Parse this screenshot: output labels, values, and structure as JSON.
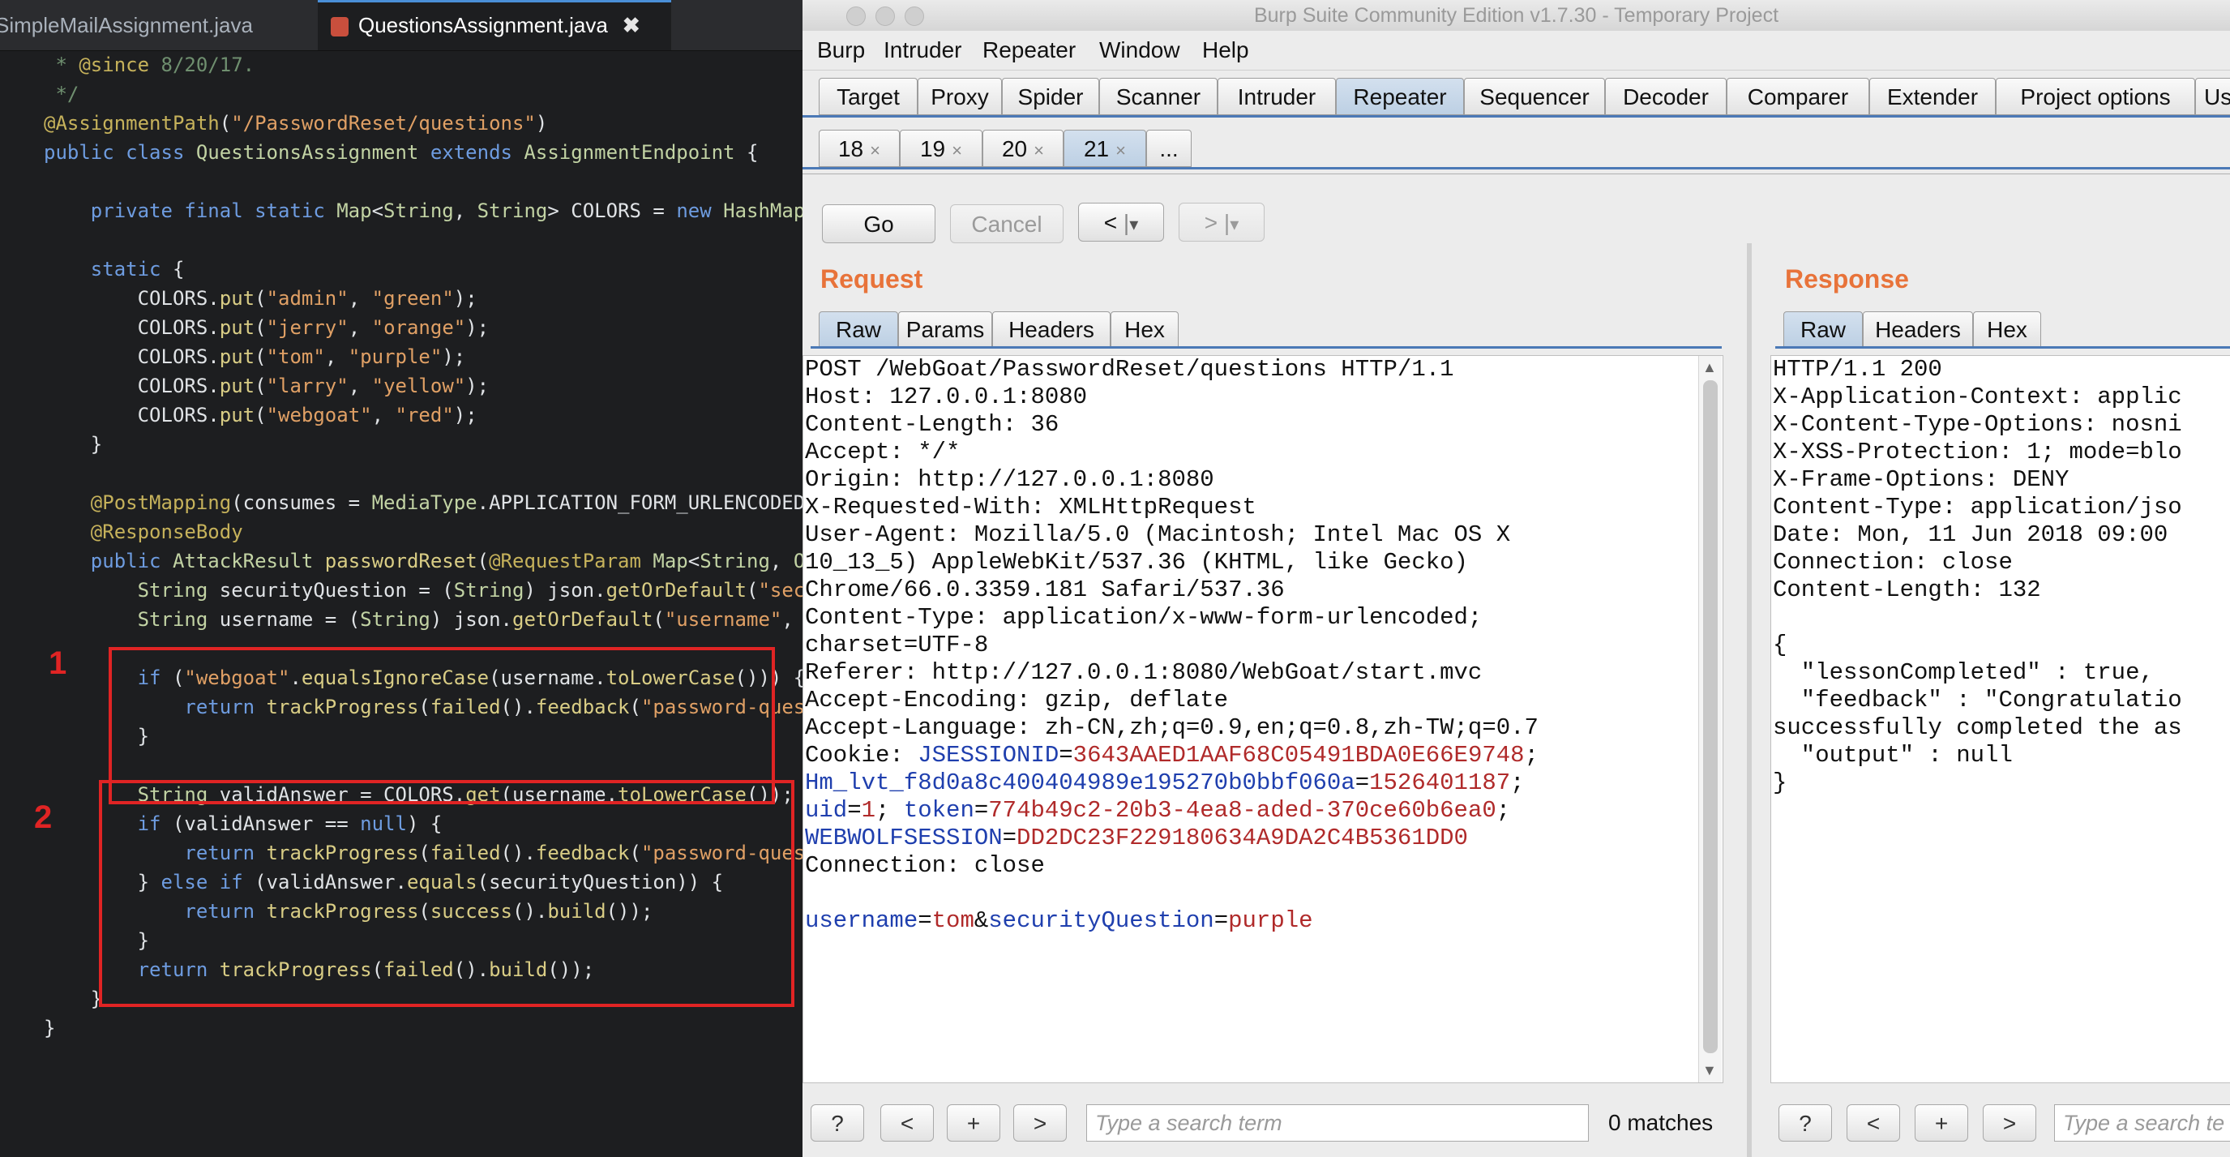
{
  "ide": {
    "tabs": [
      {
        "label": "SimpleMailAssignment.java",
        "active": false
      },
      {
        "label": "QuestionsAssignment.java",
        "active": true,
        "close": "✖"
      }
    ],
    "annotations": [
      "1",
      "2"
    ]
  },
  "burp": {
    "title": "Burp Suite Community Edition v1.7.30 - Temporary Project",
    "menu": [
      "Burp",
      "Intruder",
      "Repeater",
      "Window",
      "Help"
    ],
    "tool_tabs": [
      "Target",
      "Proxy",
      "Spider",
      "Scanner",
      "Intruder",
      "Repeater",
      "Sequencer",
      "Decoder",
      "Comparer",
      "Extender",
      "Project options",
      "Us"
    ],
    "active_tool_tab": "Repeater",
    "repeater_tabs": [
      "18",
      "19",
      "20",
      "21"
    ],
    "active_repeater_tab": "21",
    "repeater_more": "...",
    "tab_close": "×",
    "controls": {
      "go": "Go",
      "cancel": "Cancel",
      "back": "<",
      "forward": ">",
      "dropdown": "▾",
      "sep": "|"
    },
    "request": {
      "title": "Request",
      "tabs": [
        "Raw",
        "Params",
        "Headers",
        "Hex"
      ],
      "active_tab": "Raw",
      "lines": [
        "POST /WebGoat/PasswordReset/questions HTTP/1.1",
        "Host: 127.0.0.1:8080",
        "Content-Length: 36",
        "Accept: */*",
        "Origin: http://127.0.0.1:8080",
        "X-Requested-With: XMLHttpRequest",
        "User-Agent: Mozilla/5.0 (Macintosh; Intel Mac OS X",
        "10_13_5) AppleWebKit/537.36 (KHTML, like Gecko)",
        "Chrome/66.0.3359.181 Safari/537.36",
        "Content-Type: application/x-www-form-urlencoded;",
        "charset=UTF-8",
        "Referer: http://127.0.0.1:8080/WebGoat/start.mvc",
        "Accept-Encoding: gzip, deflate",
        "Accept-Language: zh-CN,zh;q=0.9,en;q=0.8,zh-TW;q=0.7"
      ],
      "cookie_label": "Cookie: ",
      "cookies": [
        {
          "name": "JSESSIONID",
          "value": "3643AAED1AAF68C05491BDA0E66E9748",
          "sep": ";"
        },
        {
          "name": "Hm_lvt_f8d0a8c400404989e195270b0bbf060a",
          "value": "1526401187",
          "sep": ";"
        },
        {
          "name": "uid",
          "value": "1",
          "sep": ";"
        },
        {
          "name": "token",
          "value": "774b49c2-20b3-4ea8-aded-370ce60b6ea0",
          "sep": ";"
        },
        {
          "name": "WEBWOLFSESSION",
          "value": "DD2DC23F229180634A9DA2C4B5361DD0",
          "sep": ""
        }
      ],
      "connection": "Connection: close",
      "body": [
        {
          "name": "username",
          "value": "tom"
        },
        {
          "name": "securityQuestion",
          "value": "purple"
        }
      ],
      "search_placeholder": "Type a search term",
      "matches": "0 matches"
    },
    "response": {
      "title": "Response",
      "tabs": [
        "Raw",
        "Headers",
        "Hex"
      ],
      "active_tab": "Raw",
      "lines": [
        "HTTP/1.1 200",
        "X-Application-Context: applic",
        "X-Content-Type-Options: nosni",
        "X-XSS-Protection: 1; mode=blo",
        "X-Frame-Options: DENY",
        "Content-Type: application/jso",
        "Date: Mon, 11 Jun 2018 09:00",
        "Connection: close",
        "Content-Length: 132",
        "",
        "{",
        "  \"lessonCompleted\" : true,",
        "  \"feedback\" : \"Congratulatio",
        "successfully completed the as",
        "  \"output\" : null",
        "}"
      ],
      "search_placeholder": "Type a search te"
    },
    "footer_buttons": {
      "help": "?",
      "prev": "<",
      "add": "+",
      "next": ">"
    }
  }
}
